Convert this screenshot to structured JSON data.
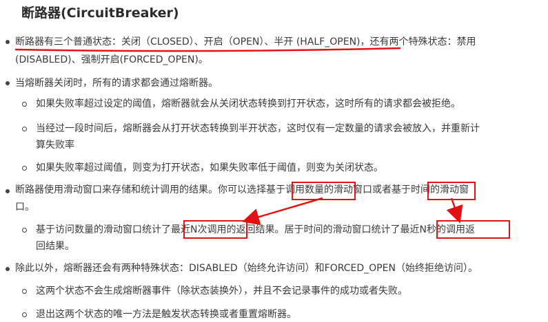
{
  "title": "断路器(CircuitBreaker)",
  "p1": {
    "line1": "断路器有三个普通状态：关闭（CLOSED）、开启（OPEN）、半开 (HALF_OPEN)，还有两个特殊状态：禁用",
    "line2": "(DISABLED)、强制开启(FORCED_OPEN)。"
  },
  "p2": "当熔断器关闭时，所有的请求都会通过熔断器。",
  "p2_sub1": "如果失败率超过设定的阈值，熔断器就会从关闭状态转换到打开状态，这时所有的请求都会被拒绝。",
  "p2_sub2": {
    "line1": "当经过一段时间后，熔断器会从打开状态转换到半开状态，这时仅有一定数量的请求会被放入，并重新计",
    "line2": "算失败率"
  },
  "p2_sub3": "如果失败率超过阈值，则变为打开状态，如果失败率低于阈值，则变为关闭状态。",
  "p3": {
    "line1": "断路器使用滑动窗口来存储和统计调用的结果。你可以选择基于调用数量的滑动窗口或者基于时间的滑动窗",
    "line2": "口。"
  },
  "p3_sub1": {
    "line1": "基于访问数量的滑动窗口统计了最近N次调用的返回结果。居于时间的滑动窗口统计了最近N秒的调用返",
    "line2": "回结果。"
  },
  "p4": "除此以外，熔断器还会有两种特殊状态：DISABLED（始终允许访问）和FORCED_OPEN（始终拒绝访问）。",
  "p4_sub1": "这两个状态不会生成熔断器事件（除状态装换外），并且不会记录事件的成功或者失败。",
  "p4_sub2": "退出这两个状态的唯一方法是触发状态转换或者重置熔断器。",
  "annotation_color": "#e31212"
}
